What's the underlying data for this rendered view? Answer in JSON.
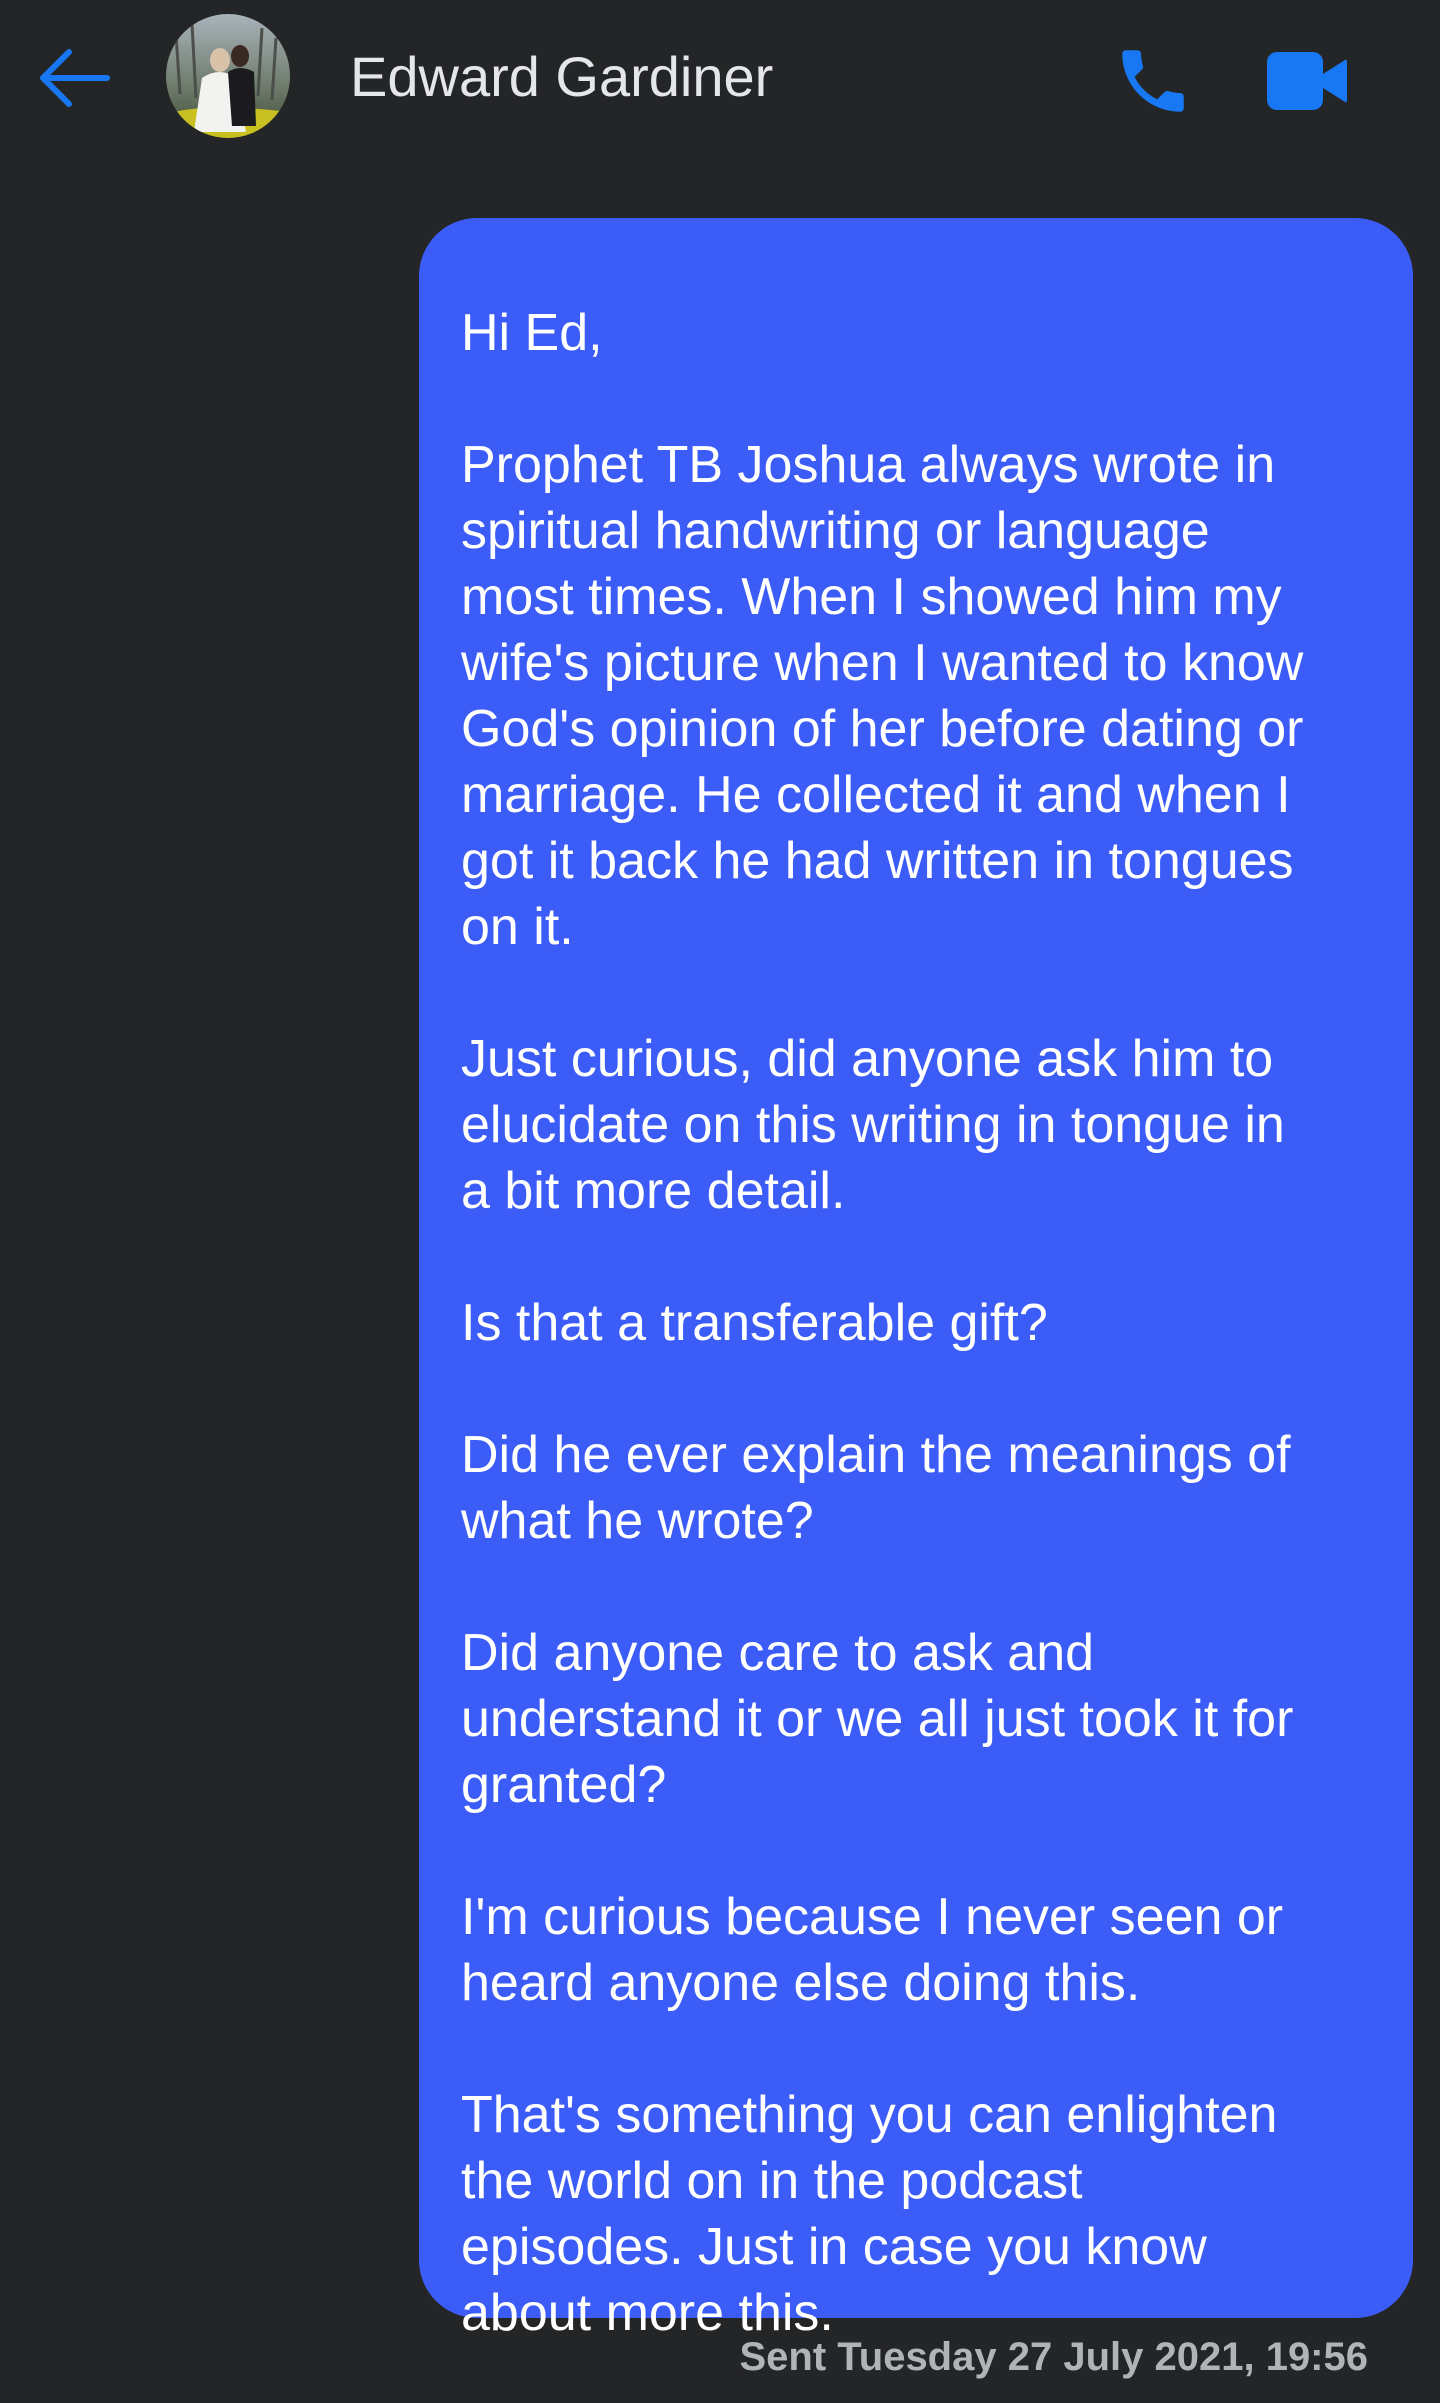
{
  "header": {
    "contact_name": "Edward Gardiner",
    "icons": {
      "back": "back-arrow-icon",
      "call": "phone-icon",
      "video": "video-camera-icon"
    }
  },
  "conversation": {
    "message": {
      "paragraphs": [
        "Hi Ed,",
        "Prophet TB Joshua always wrote in\nspiritual handwriting or language\nmost times. When I showed him my\nwife's picture when I wanted to know\nGod's opinion of her before dating or\nmarriage. He collected it and when I\ngot it back he had written in tongues\non it.",
        "Just curious, did anyone ask him to\nelucidate on this writing in tongue in\na bit more detail.",
        "Is that a transferable gift?",
        "Did he ever explain the meanings of\nwhat he wrote?",
        "Did anyone care to ask and\nunderstand it or we all just took it for\ngranted?",
        "I'm curious because I never seen or\nheard anyone else doing this.",
        "That's something you can enlighten\nthe world on in the podcast\nepisodes. Just in case you know\nabout more this."
      ],
      "timestamp": "Sent Tuesday 27 July 2021, 19:56"
    }
  },
  "colors": {
    "background": "#242526",
    "bubble": "#3c5cf8",
    "accent": "#1877f2",
    "text": "#ffffff",
    "muted": "#b0b3b8"
  }
}
